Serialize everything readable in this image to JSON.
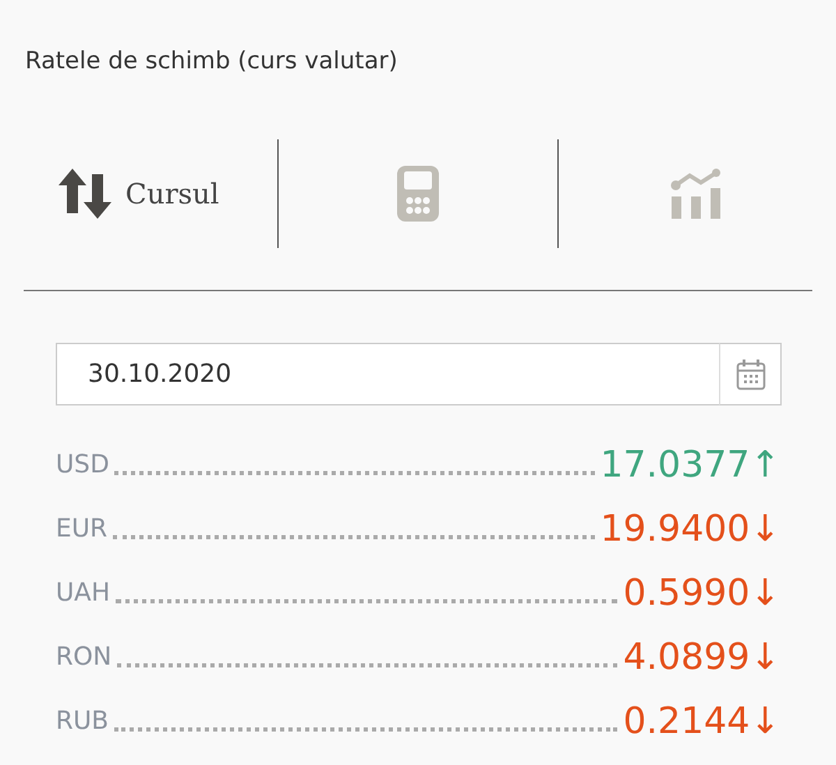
{
  "title": "Ratele de schimb (curs valutar)",
  "tabs": [
    {
      "kind": "rates",
      "label": "Cursul",
      "selected": true
    },
    {
      "kind": "calculator",
      "selected": false
    },
    {
      "kind": "chart",
      "selected": false
    }
  ],
  "date_field": {
    "value": "30.10.2020"
  },
  "rates": [
    {
      "code": "USD",
      "value": "17.0377",
      "arrow": "↑",
      "kind": "up"
    },
    {
      "code": "EUR",
      "value": "19.9400",
      "arrow": "↓",
      "kind": "down"
    },
    {
      "code": "UAH",
      "value": "0.5990",
      "arrow": "↓",
      "kind": "down"
    },
    {
      "code": "RON",
      "value": "4.0899",
      "arrow": "↓",
      "kind": "down"
    },
    {
      "code": "RUB",
      "value": "0.2144",
      "arrow": "↓",
      "kind": "down"
    }
  ]
}
